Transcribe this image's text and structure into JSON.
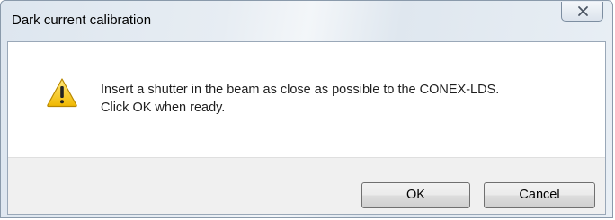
{
  "window": {
    "title": "Dark current calibration"
  },
  "title_bar": {
    "close_icon": "close-icon"
  },
  "message": {
    "icon": "warning-icon",
    "line1": "Insert a shutter in the beam as close as possible to the CONEX-LDS.",
    "line2": "Click OK when ready."
  },
  "buttons": {
    "ok_label": "OK",
    "cancel_label": "Cancel"
  },
  "colors": {
    "warning_yellow": "#f5c400",
    "frame_blue": "#dde6ef"
  }
}
